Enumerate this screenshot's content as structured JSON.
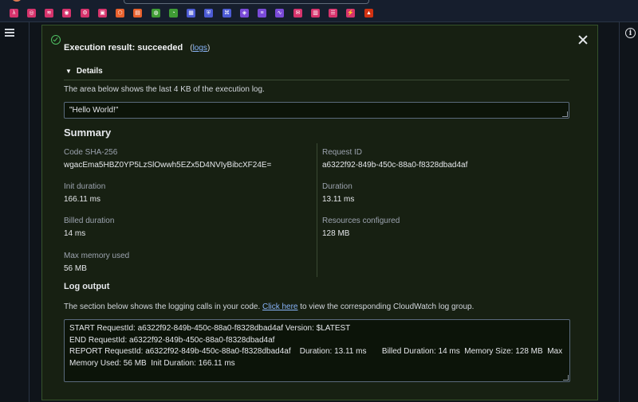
{
  "favorites": [
    {
      "icon": "lambda-icon",
      "color": "#d6336c"
    },
    {
      "icon": "search-icon",
      "color": "#d6336c"
    },
    {
      "icon": "analytics-icon",
      "color": "#d6336c"
    },
    {
      "icon": "bot-icon",
      "color": "#d6336c"
    },
    {
      "icon": "settings-icon",
      "color": "#d6336c"
    },
    {
      "icon": "monitor-icon",
      "color": "#d6336c"
    },
    {
      "icon": "compute-icon",
      "color": "#e8602c"
    },
    {
      "icon": "container-icon",
      "color": "#e8602c"
    },
    {
      "icon": "storage-icon",
      "color": "#3f9c35"
    },
    {
      "icon": "bucket-icon",
      "color": "#3f9c35"
    },
    {
      "icon": "database-icon",
      "color": "#4c5bd4"
    },
    {
      "icon": "shield-icon",
      "color": "#4c5bd4"
    },
    {
      "icon": "network-icon",
      "color": "#4c5bd4"
    },
    {
      "icon": "gateway-icon",
      "color": "#7a4ad8"
    },
    {
      "icon": "queue-icon",
      "color": "#7a4ad8"
    },
    {
      "icon": "stream-icon",
      "color": "#7a4ad8"
    },
    {
      "icon": "notify-icon",
      "color": "#d6336c"
    },
    {
      "icon": "metrics-icon",
      "color": "#d6336c"
    },
    {
      "icon": "logs-icon",
      "color": "#d6336c"
    },
    {
      "icon": "events-icon",
      "color": "#d6336c"
    },
    {
      "icon": "alarm-icon",
      "color": "#d13212"
    }
  ],
  "result": {
    "title": "Execution result: succeeded",
    "open_paren": "(",
    "logs_link": "logs",
    "close_paren": ")"
  },
  "details": {
    "toggle_label": "Details",
    "description": "The area below shows the last 4 KB of the execution log.",
    "output": "\"Hello World!\""
  },
  "summary": {
    "heading": "Summary",
    "left": [
      {
        "label": "Code SHA-256",
        "value": "wgacEma5HBZ0YP5LzSlOwwh5EZx5D4NVIyBibcXF24E="
      },
      {
        "label": "Init duration",
        "value": "166.11 ms"
      },
      {
        "label": "Billed duration",
        "value": "14 ms"
      },
      {
        "label": "Max memory used",
        "value": "56 MB"
      }
    ],
    "right": [
      {
        "label": "Request ID",
        "value": "a6322f92-849b-450c-88a0-f8328dbad4af"
      },
      {
        "label": "Duration",
        "value": "13.11 ms"
      },
      {
        "label": "Resources configured",
        "value": "128 MB"
      }
    ]
  },
  "log_output": {
    "heading": "Log output",
    "desc_before": "The section below shows the logging calls in your code.",
    "link": "Click here",
    "desc_after": "to view the corresponding CloudWatch log group.",
    "content": "START RequestId: a6322f92-849b-450c-88a0-f8328dbad4af Version: $LATEST\nEND RequestId: a6322f92-849b-450c-88a0-f8328dbad4af\nREPORT RequestId: a6322f92-849b-450c-88a0-f8328dbad4af    Duration: 13.11 ms       Billed Duration: 14 ms  Memory Size: 128 MB  Max Memory Used: 56 MB  Init Duration: 166.11 ms"
  },
  "colors": {
    "success": "#4fbf63",
    "link": "#89b4fa",
    "panel_bg": "#172012"
  }
}
